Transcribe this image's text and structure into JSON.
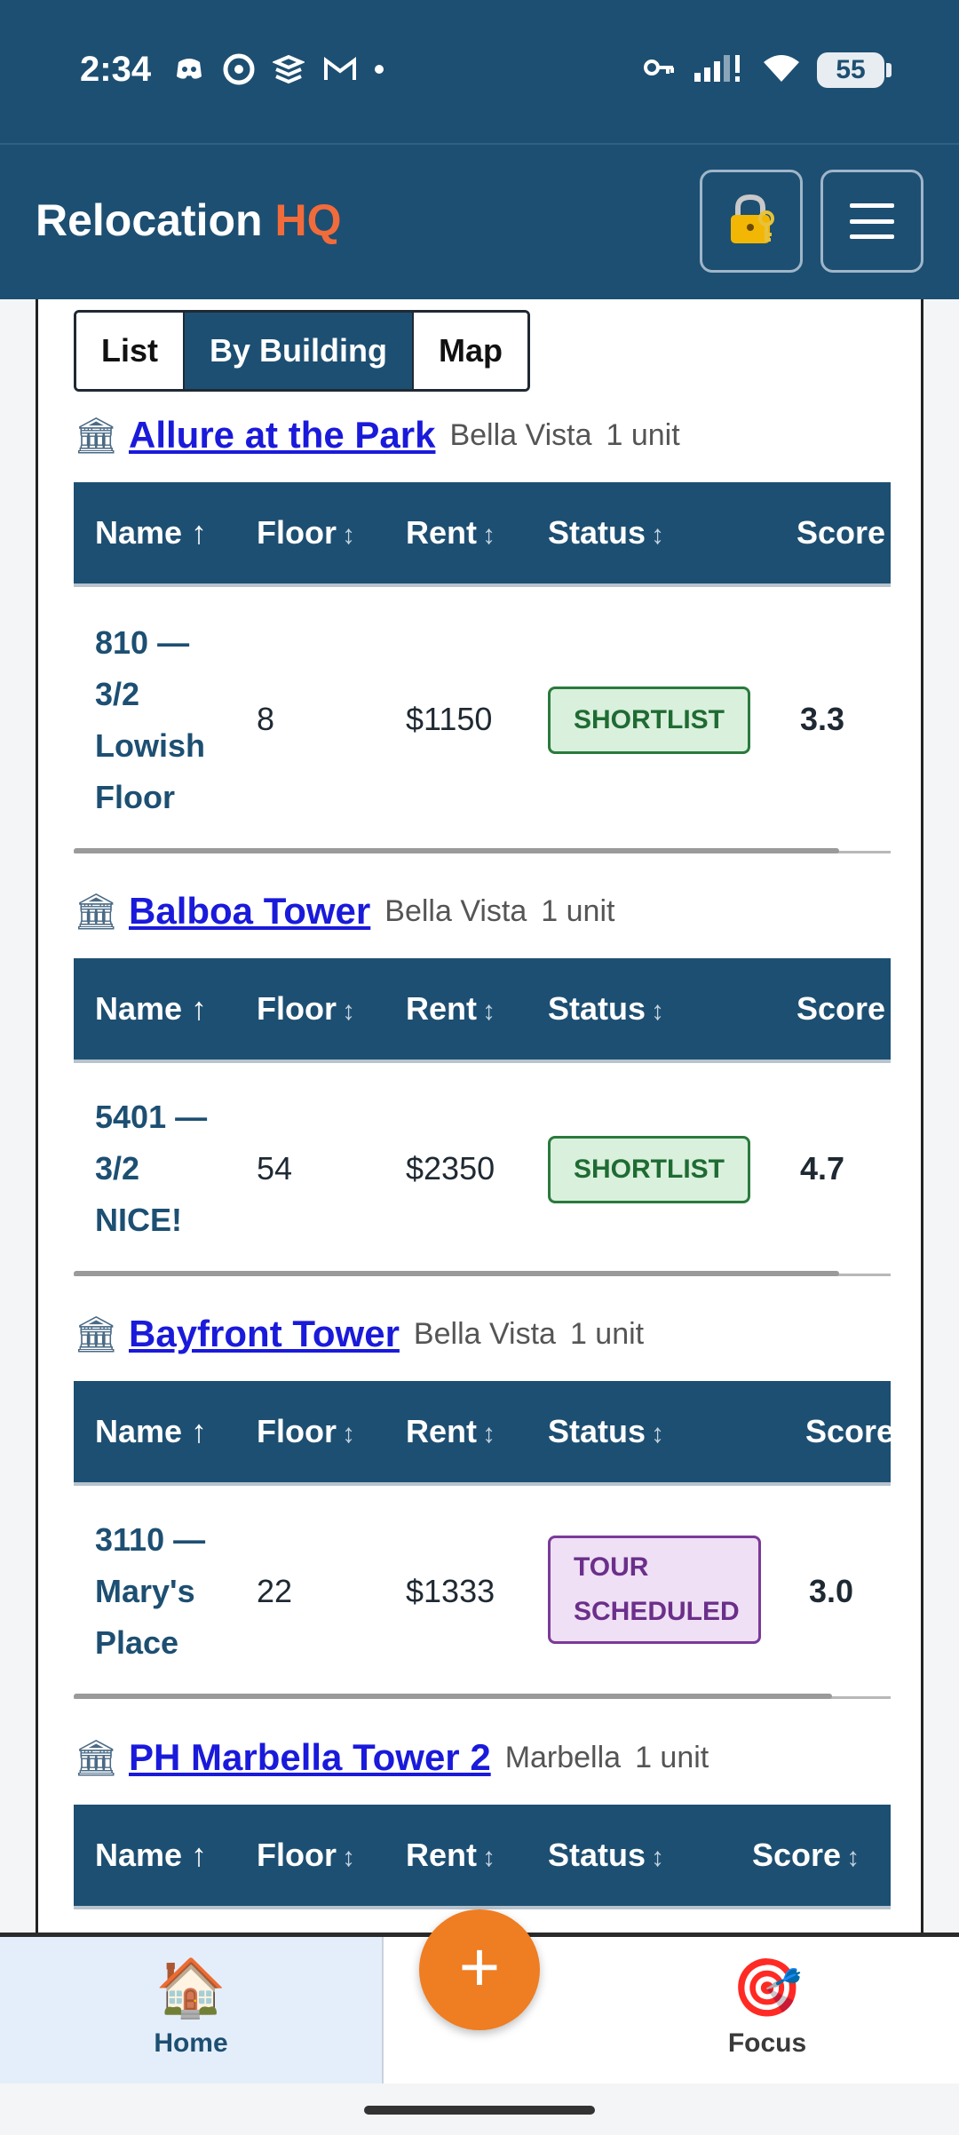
{
  "status_bar": {
    "time": "2:34",
    "battery": "55"
  },
  "header": {
    "title_main": "Relocation",
    "title_accent": "HQ",
    "lock_icon": "lock-key-icon",
    "menu_icon": "hamburger-icon"
  },
  "view_toggle": {
    "options": [
      "List",
      "By Building",
      "Map"
    ],
    "selected": "By Building"
  },
  "table_columns": {
    "name": "Name",
    "name_sort": "↑",
    "floor": "Floor",
    "rent": "Rent",
    "status": "Status",
    "score": "Score",
    "sort": "↕"
  },
  "buildings": [
    {
      "name": "Allure at the Park",
      "area": "Bella Vista",
      "count": "1 unit",
      "units": [
        {
          "name_lines": [
            "810 —",
            "3/2",
            "Lowish",
            "Floor"
          ],
          "floor": "8",
          "rent": "$1150",
          "status": "SHORTLIST",
          "score": "3.3"
        }
      ]
    },
    {
      "name": "Balboa Tower",
      "area": "Bella Vista",
      "count": "1 unit",
      "units": [
        {
          "name_lines": [
            "5401 —",
            "3/2",
            "NICE!"
          ],
          "floor": "54",
          "rent": "$2350",
          "status": "SHORTLIST",
          "score": "4.7"
        }
      ]
    },
    {
      "name": "Bayfront Tower",
      "area": "Bella Vista",
      "count": "1 unit",
      "units": [
        {
          "name_lines": [
            "3110 —",
            "Mary's",
            "Place"
          ],
          "floor": "22",
          "rent": "$1333",
          "status_lines": [
            "TOUR",
            "SCHEDULED"
          ],
          "score": "3.0"
        }
      ]
    },
    {
      "name": "PH Marbella Tower 2",
      "area": "Marbella",
      "count": "1 unit",
      "units": []
    }
  ],
  "bottom_nav": {
    "home": "Home",
    "focus": "Focus",
    "fab": "+"
  },
  "colors": {
    "primary": "#1d4f72",
    "accent": "#f26b3a",
    "fab": "#ef7d22"
  }
}
